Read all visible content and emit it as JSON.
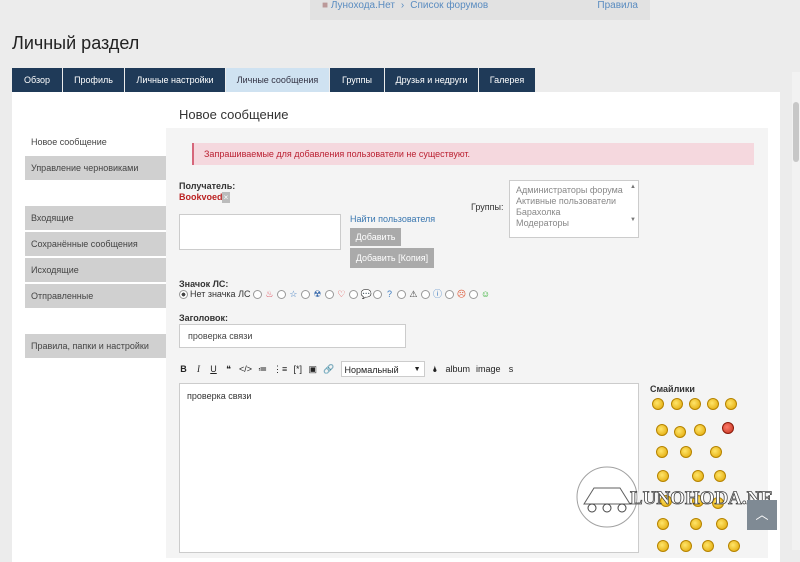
{
  "breadcrumb": [
    "Луноходa.Нет",
    "Список форумов"
  ],
  "rules_link": "Правила",
  "page_title": "Личный раздел",
  "tabs": [
    "Обзор",
    "Профиль",
    "Личные настройки",
    "Личные сообщения",
    "Группы",
    "Друзья и недруги",
    "Галерея"
  ],
  "active_tab": "Личные сообщения",
  "sidebar": {
    "group1": [
      "Новое сообщение",
      "Управление черновиками"
    ],
    "group2": [
      "Входящие",
      "Сохранённые сообщения",
      "Исходящие",
      "Отправленные"
    ],
    "group3": [
      "Правила, папки и настройки"
    ]
  },
  "main_title": "Новое сообщение",
  "alert": "Запрашиваемые для добавления пользователи не существуют.",
  "recipient_label": "Получатель:",
  "recipient_name": "Bookvoed",
  "find_user": "Найти пользователя",
  "btn_add": "Добавить",
  "btn_add_copy": "Добавить [Копия]",
  "groups_label": "Группы:",
  "groups": [
    "Администраторы форума",
    "Активные пользователи",
    "Барахолка",
    "Модераторы"
  ],
  "icon_label": "Значок ЛС:",
  "icon_none": "Нет значка ЛС",
  "subject_label": "Заголовок:",
  "subject_value": "проверка связи",
  "toolbar": {
    "bold": "B",
    "italic": "I",
    "underline": "U",
    "quote": "❝",
    "code": "</>",
    "list": "≔",
    "olist": "⋮≡",
    "listitem": "[*]",
    "font_size": "Нормальный",
    "album": "album",
    "image": "image",
    "s": "s"
  },
  "message_text": "проверка связи",
  "smilies_title": "Смайлики",
  "watermark": "LUNOHODA.NET"
}
